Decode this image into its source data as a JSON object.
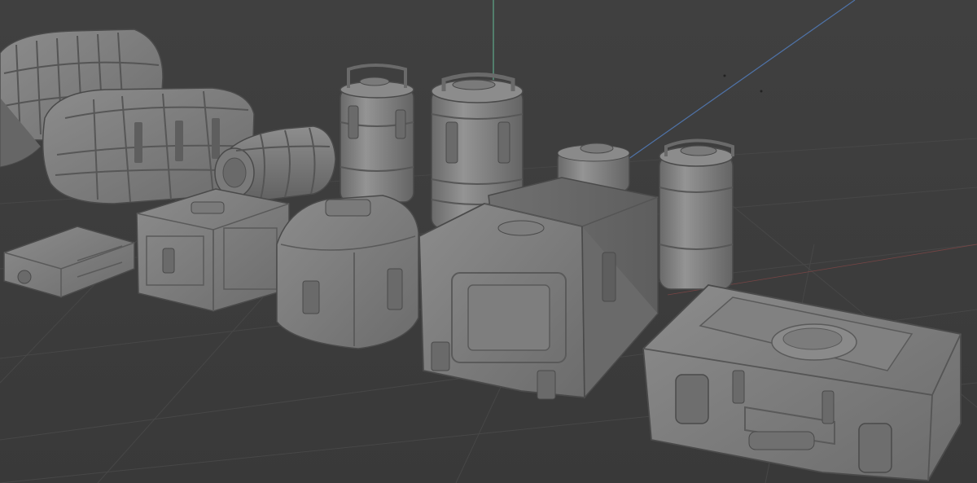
{
  "viewport": {
    "background_color": "#3d3d3d",
    "grid_color": "#474747",
    "z_axis_color": "#5fa88a",
    "y_axis_color": "#4f73a8",
    "x_axis_color": "#a04a4a",
    "mesh_base_color": "#7a7a7a",
    "mesh_light_color": "#8e8e8e",
    "mesh_dark_color": "#5a5a5a",
    "mesh_line_color": "#4a4a4a"
  }
}
